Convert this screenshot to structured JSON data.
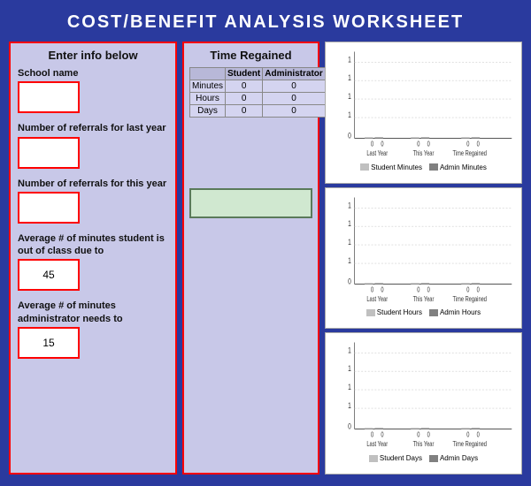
{
  "title": "COST/BENEFIT ANALYSIS WORKSHEET",
  "left_panel": {
    "header": "Enter info below",
    "fields": [
      {
        "label": "School name",
        "value": "",
        "id": "school-name"
      },
      {
        "label": "Number of referrals for last year",
        "value": "",
        "id": "referrals-last"
      },
      {
        "label": "Number of referrals for this year",
        "value": "",
        "id": "referrals-this"
      },
      {
        "label": "Average # of minutes student is out of class due to",
        "value": "45",
        "id": "avg-minutes-student"
      },
      {
        "label": "Average # of minutes administrator needs to",
        "value": "15",
        "id": "avg-minutes-admin"
      }
    ]
  },
  "middle_panel": {
    "header": "Time Regained",
    "table": {
      "columns": [
        "",
        "Student",
        "Administrator"
      ],
      "rows": [
        {
          "label": "Minutes",
          "student": "0",
          "admin": "0"
        },
        {
          "label": "Hours",
          "student": "0",
          "admin": "0"
        },
        {
          "label": "Days",
          "student": "0",
          "admin": "0"
        }
      ]
    }
  },
  "charts": [
    {
      "id": "minutes-chart",
      "y_labels": [
        "1",
        "1",
        "1",
        "1",
        "0"
      ],
      "x_labels": [
        "Last Year",
        "This Year",
        "Time Regained"
      ],
      "x_ticks": [
        "0",
        "0",
        "0",
        "0",
        "0",
        "0"
      ],
      "legend": [
        "Student Minutes",
        "Admin Minutes"
      ]
    },
    {
      "id": "hours-chart",
      "y_labels": [
        "1",
        "1",
        "1",
        "1",
        "0"
      ],
      "x_labels": [
        "Last Year",
        "This Year",
        "Time Regained"
      ],
      "x_ticks": [
        "0",
        "0",
        "0",
        "0",
        "0",
        "0"
      ],
      "legend": [
        "Student Hours",
        "Admin Hours"
      ]
    },
    {
      "id": "days-chart",
      "y_labels": [
        "1",
        "1",
        "1",
        "1",
        "0"
      ],
      "x_labels": [
        "Last Year",
        "This Year",
        "Time Regained"
      ],
      "x_ticks": [
        "0",
        "0",
        "0",
        "0",
        "0",
        "0"
      ],
      "legend": [
        "Student Days",
        "Admin Days"
      ]
    }
  ]
}
